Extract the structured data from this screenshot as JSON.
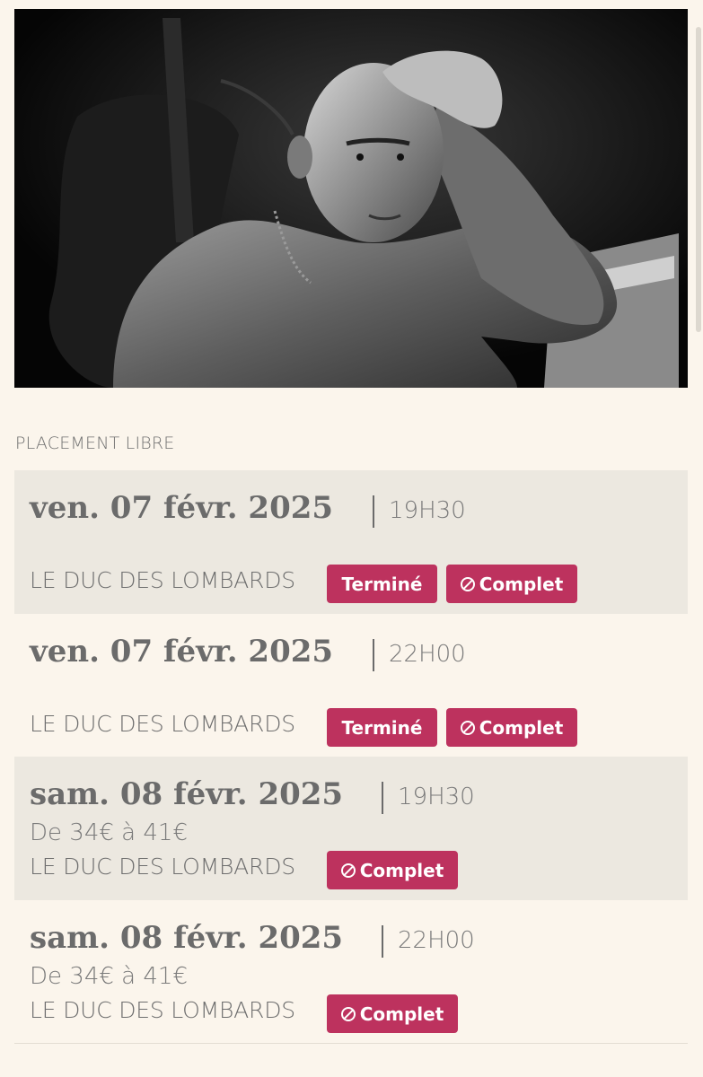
{
  "photo": {
    "icon": "artist-portrait"
  },
  "placement_label": "PLACEMENT LIBRE",
  "events": [
    {
      "date": "ven. 07 févr. 2025",
      "time": "19H30",
      "price": "",
      "venue": "LE DUC DES LOMBARDS",
      "badges": [
        "Terminé",
        "Complet"
      ]
    },
    {
      "date": "ven. 07 févr. 2025",
      "time": "22H00",
      "price": "",
      "venue": "LE DUC DES LOMBARDS",
      "badges": [
        "Terminé",
        "Complet"
      ]
    },
    {
      "date": "sam. 08 févr. 2025",
      "time": "19H30",
      "price": "De 34€ à 41€",
      "venue": "LE DUC DES LOMBARDS",
      "badges": [
        "Complet"
      ]
    },
    {
      "date": "sam. 08 févr. 2025",
      "time": "22H00",
      "price": "De 34€ à 41€",
      "venue": "LE DUC DES LOMBARDS",
      "badges": [
        "Complet"
      ]
    }
  ],
  "colors": {
    "background": "#fbf5ec",
    "shaded_row": "#ece8e0",
    "badge": "#bd325e",
    "text": "#6b6b6b"
  }
}
